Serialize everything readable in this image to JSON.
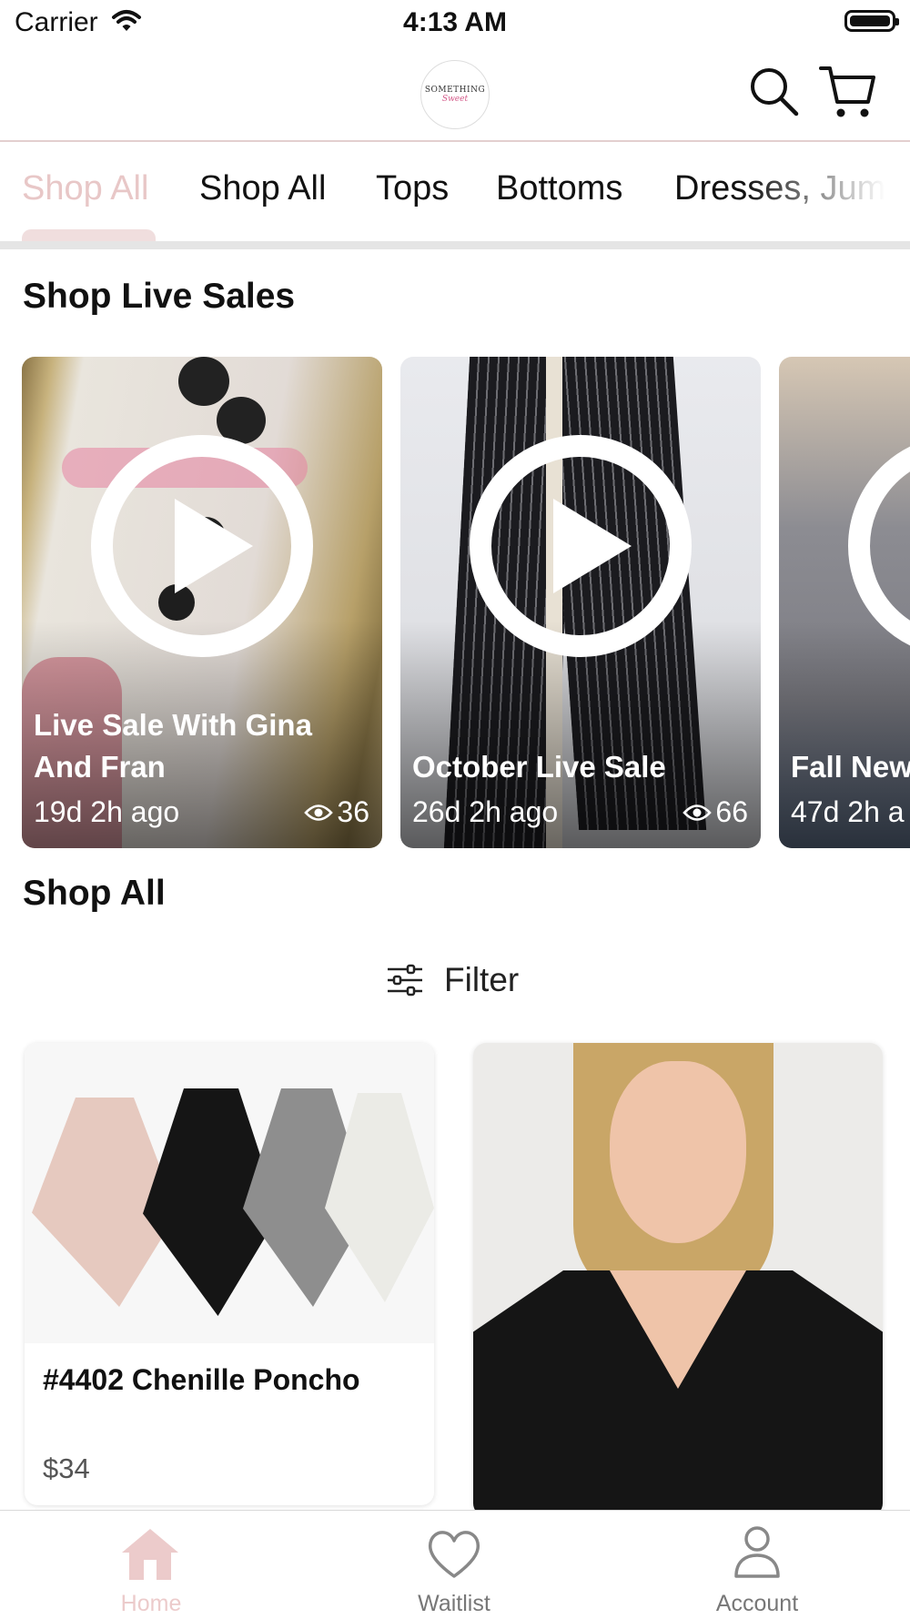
{
  "status_bar": {
    "carrier": "Carrier",
    "time": "4:13 AM"
  },
  "header": {
    "logo_line1": "SOMETHING",
    "logo_line2": "Sweet"
  },
  "tabs": [
    {
      "label": "Shop All",
      "active": true
    },
    {
      "label": "Shop All",
      "active": false
    },
    {
      "label": "Tops",
      "active": false
    },
    {
      "label": "Bottoms",
      "active": false
    },
    {
      "label": "Dresses, Jum",
      "active": false
    }
  ],
  "live_section": {
    "title": "Shop Live Sales",
    "cards": [
      {
        "title": "Live Sale With Gina And Fran",
        "ago": "19d 2h ago",
        "views": "36"
      },
      {
        "title": "October Live Sale",
        "ago": "26d 2h ago",
        "views": "66"
      },
      {
        "title": "Fall New",
        "ago": "47d 2h a",
        "views": ""
      }
    ]
  },
  "shop_section": {
    "title": "Shop All",
    "filter_label": "Filter"
  },
  "products": [
    {
      "name": "#4402 Chenille Poncho",
      "price": "$34"
    },
    {
      "name": "",
      "price": ""
    }
  ],
  "tab_bar": {
    "home": "Home",
    "waitlist": "Waitlist",
    "account": "Account"
  },
  "colors": {
    "accent": "#e8c7c7",
    "tab_indicator": "#f0dede",
    "header_rule": "#e3cfcf"
  }
}
